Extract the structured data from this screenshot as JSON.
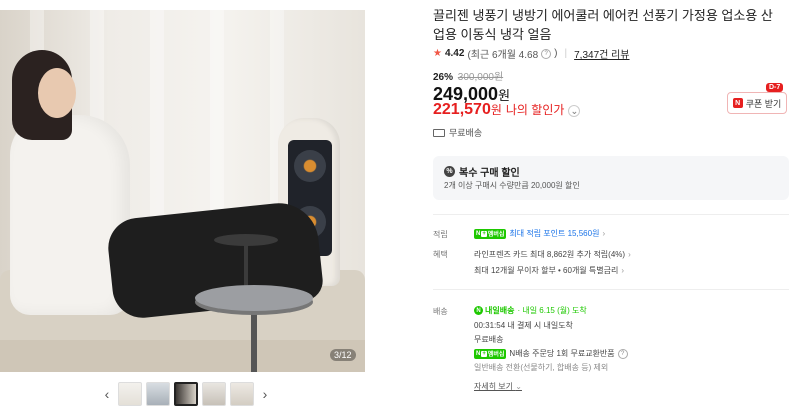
{
  "gallery": {
    "counter": "3/12",
    "prev_arrow": "‹",
    "next_arrow": "›",
    "thumb_count": 5,
    "selected_thumb": 3
  },
  "product": {
    "title": "끌리젠 냉풍기 냉방기 에어쿨러 에어컨 선풍기 가정용 업소용 산업용 이동식 냉각 얼음",
    "rating": "4.42",
    "rating_recent": "(최근 6개월 4.68",
    "review_count": "7,347건 리뷰",
    "discount_rate": "26%",
    "original_price": "300,000원",
    "price": "249,000",
    "price_unit": "원",
    "my_price": "221,570",
    "my_price_unit": "원",
    "my_price_label": "나의 할인가",
    "coupon_label": "쿠폰 받기",
    "coupon_dday": "D-7",
    "shipping": "무료배송"
  },
  "bulk": {
    "title": "복수 구매 할인",
    "desc": "2개 이상 구매시 수량만큼 20,000원 할인"
  },
  "benefits": {
    "points_label": "적립",
    "npay_label": "멤버십",
    "points_text": "최대 적립 포인트 15,560원",
    "perks_label": "혜택",
    "perk1": "라인프렌즈 카드 최대 8,862원 추가 적립(4%)",
    "perk2": "최대 12개월 무이자 할부 • 60개월 특별금리"
  },
  "delivery": {
    "label": "배송",
    "tomorrow": "내일배송",
    "eta": "· 내일 6.15 (월) 도착",
    "deadline": "00:31:54  내 결제 시 내일도착",
    "free": "무료배송",
    "return": "N배송 주문당 1회 무료교환반품",
    "exclusion": "일반배송 전환(선물하기, 합배송 등) 제외",
    "details": "자세히 보기"
  },
  "colors": {
    "accent_red": "#e61f1f",
    "naver_green": "#1ec800",
    "point_blue": "#1a73e8"
  }
}
